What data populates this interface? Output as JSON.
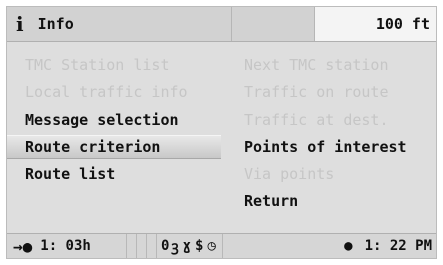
{
  "header": {
    "icon": "info-icon",
    "title": "Info",
    "distance": "100 ft"
  },
  "menu": {
    "left": [
      {
        "label": "TMC Station list",
        "enabled": false
      },
      {
        "label": "Local traffic info",
        "enabled": false
      },
      {
        "label": "Message selection",
        "enabled": true
      },
      {
        "label": "Route criterion",
        "enabled": true,
        "selected": true
      },
      {
        "label": "Route list",
        "enabled": true
      }
    ],
    "right": [
      {
        "label": "Next TMC station",
        "enabled": false
      },
      {
        "label": "Traffic on route",
        "enabled": false
      },
      {
        "label": "Traffic at dest.",
        "enabled": false
      },
      {
        "label": "Points of interest",
        "enabled": true
      },
      {
        "label": "Via points",
        "enabled": false
      },
      {
        "label": "Return",
        "enabled": true
      }
    ]
  },
  "footer": {
    "travel_time": "1: 03h",
    "satellite_count": "0",
    "clock": "1: 22 PM",
    "icons": [
      "arrow-right-icon",
      "satellite-icon",
      "antenna-icon",
      "dollar-icon",
      "clock-icon",
      "dot-icon"
    ]
  }
}
